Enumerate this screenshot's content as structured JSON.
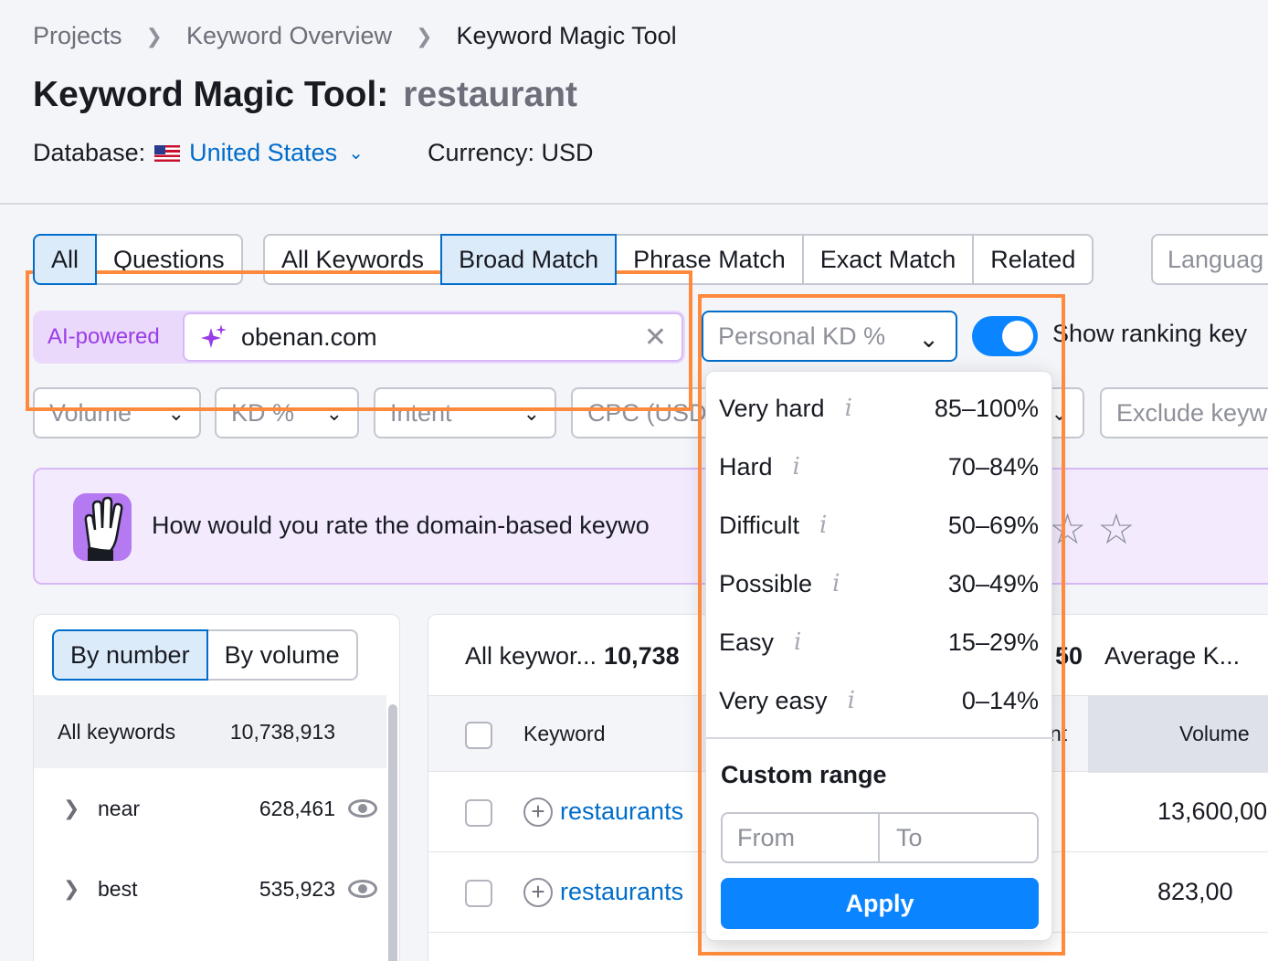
{
  "breadcrumb": [
    "Projects",
    "Keyword Overview",
    "Keyword Magic Tool"
  ],
  "title": {
    "tool": "Keyword Magic Tool:",
    "query": "restaurant"
  },
  "database": {
    "label": "Database:",
    "country": "United States",
    "currency": "Currency: USD"
  },
  "tabs_type": [
    "All",
    "Questions"
  ],
  "tabs_match": [
    "All Keywords",
    "Broad Match",
    "Phrase Match",
    "Exact Match",
    "Related"
  ],
  "language_placeholder": "Languag",
  "ai": {
    "label": "AI-powered",
    "domain": "obenan.com"
  },
  "personal_kd": {
    "placeholder": "Personal KD %"
  },
  "show_ranking": "Show ranking key",
  "filters": [
    "Volume",
    "KD %",
    "Intent",
    "CPC (USD"
  ],
  "exclude_placeholder": "Exclude keyw",
  "banner": {
    "text": "How would you rate the domain-based keywo"
  },
  "left_panel": {
    "tabs": [
      "By number",
      "By volume"
    ],
    "all": {
      "label": "All keywords",
      "count": "10,738,913"
    },
    "rows": [
      {
        "label": "near",
        "count": "628,461"
      },
      {
        "label": "best",
        "count": "535,923"
      }
    ]
  },
  "right_panel": {
    "all_label": "All keywor...",
    "all_count": "10,738",
    "partial_count": "50",
    "avg_label": "Average K...",
    "col_keyword": "Keyword",
    "col_partial": "nt",
    "col_volume": "Volume",
    "rows": [
      {
        "keyword": "restaurants",
        "volume": "13,600,00"
      },
      {
        "keyword": "restaurants",
        "volume": "823,00"
      }
    ]
  },
  "kd_options": [
    {
      "label": "Very hard",
      "range": "85–100%"
    },
    {
      "label": "Hard",
      "range": "70–84%"
    },
    {
      "label": "Difficult",
      "range": "50–69%"
    },
    {
      "label": "Possible",
      "range": "30–49%"
    },
    {
      "label": "Easy",
      "range": "15–29%"
    },
    {
      "label": "Very easy",
      "range": "0–14%"
    }
  ],
  "custom_range": {
    "title": "Custom range",
    "from": "From",
    "to": "To",
    "apply": "Apply"
  },
  "colors": {
    "accent": "#006dca",
    "apply": "#0a84ff",
    "highlight": "#ff8a3d",
    "ai": "#9a3de6"
  }
}
